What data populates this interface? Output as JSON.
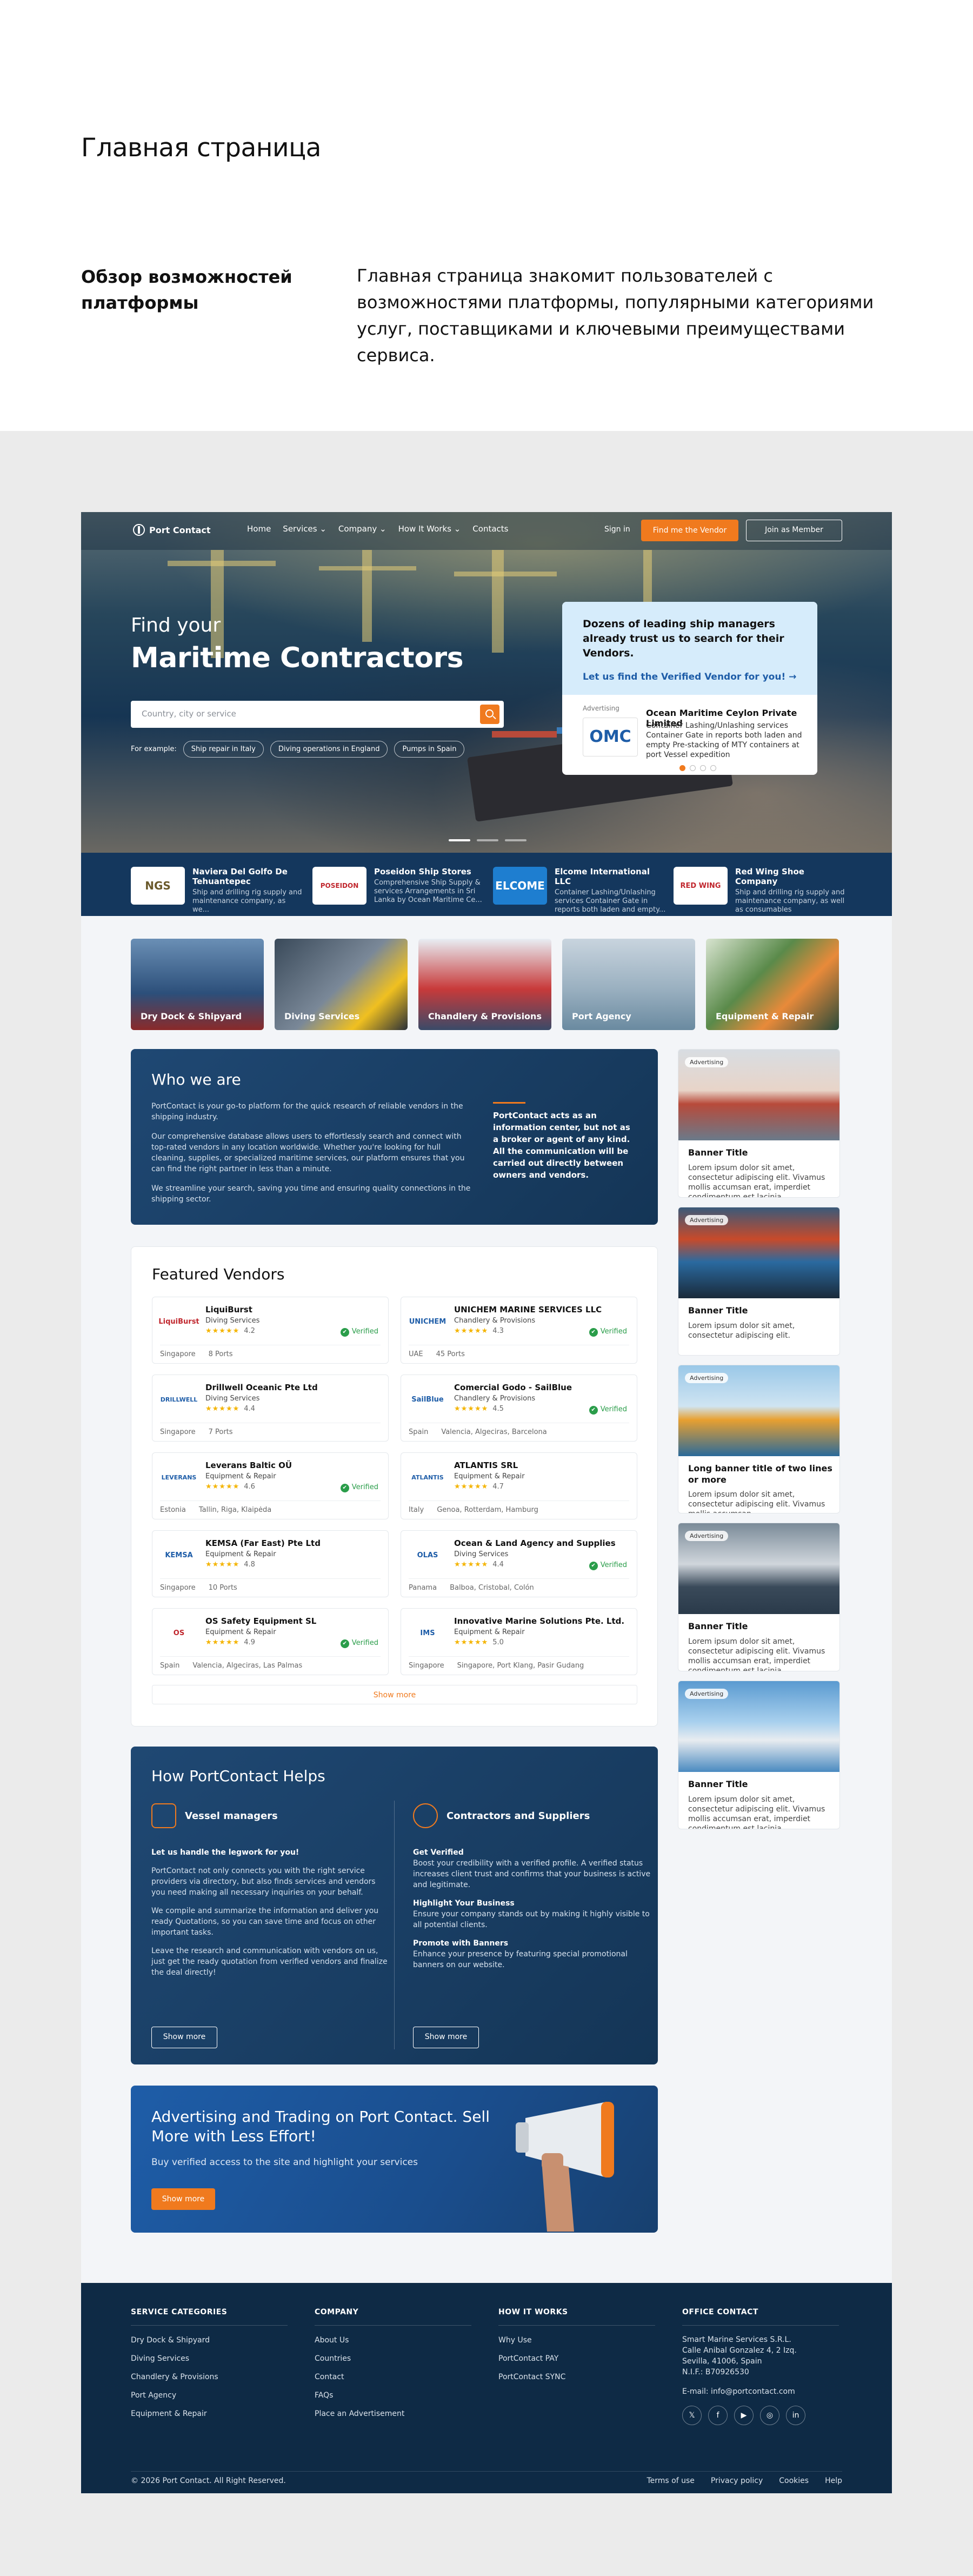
{
  "intro": {
    "title": "Главная страница",
    "subtitle": "Обзор возможностей платформы",
    "description": "Главная страница знакомит пользователей с возможностями платформы, популярными категориями услуг, поставщиками и ключевыми преимуществами сервиса."
  },
  "colors": {
    "accent": "#f07a1e",
    "navy": "#14375d",
    "blue": "#1e5da8",
    "verified": "#2a9d4a"
  },
  "nav": {
    "logo": "Port Contact",
    "links": [
      "Home",
      "Services ⌄",
      "Company ⌄",
      "How It Works ⌄",
      "Contacts"
    ],
    "signin": "Sign in",
    "find_vendor": "Find me the Vendor",
    "join": "Join as Member"
  },
  "hero": {
    "find": "Find your",
    "title": "Maritime Contractors",
    "search_placeholder": "Country, city or service",
    "example_label": "For example:",
    "examples": [
      "Ship repair in Italy",
      "Diving operations in England",
      "Pumps in Spain"
    ],
    "panel": {
      "title": "Dozens of leading ship managers already trust us to search for their Vendors.",
      "link": "Let us find the Verified Vendor for you!  →",
      "adv": "Advertising",
      "logo": "OMC",
      "name": "Ocean Maritime Ceylon Private Limited",
      "desc": "Container Lashing/Unlashing services Container Gate in reports both laden and empty Pre-stacking of MTY containers at port Vessel expedition"
    }
  },
  "sponsors": [
    {
      "logo": "NGS",
      "name": "Naviera Del Golfo De Tehuantepec",
      "desc": "Ship and drilling rig supply and maintenance company, as we..."
    },
    {
      "logo": "POSEIDON",
      "name": "Poseidon Ship Stores",
      "desc": "Comprehensive Ship Supply & services Arrangements in Sri Lanka by Ocean Maritime Ce..."
    },
    {
      "logo": "ELCOME",
      "name": "Elcome International LLC",
      "desc": "Container Lashing/Unlashing services Container Gate in reports both laden and empty..."
    },
    {
      "logo": "RED WING",
      "name": "Red Wing Shoe Company",
      "desc": "Ship and drilling rig supply and maintenance company, as well as consumables"
    }
  ],
  "categories": [
    "Dry Dock & Shipyard",
    "Diving Services",
    "Chandlery & Provisions",
    "Port Agency",
    "Equipment & Repair"
  ],
  "who": {
    "title": "Who we are",
    "p1": "PortContact is your go-to platform for the quick research of reliable vendors in the shipping industry.",
    "p2": "Our comprehensive database allows users to effortlessly search and connect with top-rated vendors in any location worldwide. Whether you're looking for hull cleaning, supplies, or specialized maritime services, our platform ensures that you can find the right partner in less than a minute.",
    "p3": "We streamline your search, saving you time and ensuring quality connections in the shipping sector.",
    "quote": "PortContact acts as an information center, but not as a broker or agent of any kind. All the communication will be carried out directly between owners and vendors."
  },
  "featured": {
    "title": "Featured Vendors",
    "show_more": "Show more",
    "vendors": [
      {
        "logo": "LiquiBurst",
        "name": "LiquiBurst",
        "service": "Diving Services",
        "stars": "★★★★★",
        "rating": "4.2",
        "verified": "Verified",
        "loc": "Singapore",
        "ports": "8 Ports"
      },
      {
        "logo": "UNICHEM",
        "name": "UNICHEM MARINE SERVICES LLC",
        "service": "Chandlery & Provisions",
        "stars": "★★★★★",
        "rating": "4.3",
        "verified": "Verified",
        "loc": "UAE",
        "ports": "45 Ports"
      },
      {
        "logo": "DRILLWELL",
        "name": "Drillwell Oceanic Pte Ltd",
        "service": "Diving Services",
        "stars": "★★★★★",
        "rating": "4.4",
        "verified": "",
        "loc": "Singapore",
        "ports": "7 Ports"
      },
      {
        "logo": "SailBlue",
        "name": "Comercial Godo - SailBlue",
        "service": "Chandlery & Provisions",
        "stars": "★★★★★",
        "rating": "4.5",
        "verified": "Verified",
        "loc": "Spain",
        "ports": "Valencia, Algeciras, Barcelona"
      },
      {
        "logo": "LEVERANS",
        "name": "Leverans Baltic OÜ",
        "service": "Equipment & Repair",
        "stars": "★★★★★",
        "rating": "4.6",
        "verified": "Verified",
        "loc": "Estonia",
        "ports": "Tallin, Riga, Klaipėda"
      },
      {
        "logo": "ATLANTIS",
        "name": "ATLANTIS SRL",
        "service": "Equipment & Repair",
        "stars": "★★★★★",
        "rating": "4.7",
        "verified": "",
        "loc": "Italy",
        "ports": "Genoa, Rotterdam, Hamburg"
      },
      {
        "logo": "KEMSA",
        "name": "KEMSA (Far East) Pte Ltd",
        "service": "Equipment & Repair",
        "stars": "★★★★★",
        "rating": "4.8",
        "verified": "",
        "loc": "Singapore",
        "ports": "10 Ports"
      },
      {
        "logo": "OLAS",
        "name": "Ocean & Land Agency and Supplies",
        "service": "Diving Services",
        "stars": "★★★★★",
        "rating": "4.4",
        "verified": "Verified",
        "loc": "Panama",
        "ports": "Balboa, Cristobal, Colón"
      },
      {
        "logo": "OS",
        "name": "OS Safety Equipment SL",
        "service": "Equipment & Repair",
        "stars": "★★★★★",
        "rating": "4.9",
        "verified": "Verified",
        "loc": "Spain",
        "ports": "Valencia, Algeciras, Las Palmas"
      },
      {
        "logo": "IMS",
        "name": "Innovative Marine Solutions Pte. Ltd.",
        "service": "Equipment & Repair",
        "stars": "★★★★★",
        "rating": "5.0",
        "verified": "",
        "loc": "Singapore",
        "ports": "Singapore, Port Klang, Pasir Gudang"
      }
    ]
  },
  "banners": [
    {
      "tag": "Advertising",
      "title": "Banner Title",
      "desc": "Lorem ipsum dolor sit amet, consectetur adipiscing elit. Vivamus mollis accumsan erat, imperdiet condimentum est lacinia..."
    },
    {
      "tag": "Advertising",
      "title": "Banner Title",
      "desc": "Lorem ipsum dolor sit amet, consectetur adipiscing elit."
    },
    {
      "tag": "Advertising",
      "title": "Long banner title of two lines or more",
      "desc": "Lorem ipsum dolor sit amet, consectetur adipiscing elit. Vivamus mollis accumsan..."
    },
    {
      "tag": "Advertising",
      "title": "Banner Title",
      "desc": "Lorem ipsum dolor sit amet, consectetur adipiscing elit. Vivamus mollis accumsan erat, imperdiet condimentum est lacinia..."
    },
    {
      "tag": "Advertising",
      "title": "Banner Title",
      "desc": "Lorem ipsum dolor sit amet, consectetur adipiscing elit. Vivamus mollis accumsan erat, imperdiet condimentum est lacinia..."
    }
  ],
  "how": {
    "title": "How PortContact Helps",
    "vessel": {
      "head": "Vessel managers",
      "b1": "Let us handle the legwork for you!",
      "p1": "PortContact not only connects you with the right service providers via directory, but also finds services and vendors you need making all necessary inquiries on your behalf.",
      "p2": "We compile and summarize the information and deliver you ready Quotations, so you can save time and focus on other important tasks.",
      "p3": "Leave the research and communication with vendors on us, just get the ready quotation from verified vendors and finalize the deal directly!",
      "btn": "Show more"
    },
    "contractors": {
      "head": "Contractors and Suppliers",
      "b1": "Get Verified",
      "p1": "Boost your credibility with a verified profile. A verified status increases client trust and confirms that your business is active and legitimate.",
      "b2": "Highlight Your Business",
      "p2": "Ensure your company stands out by making it highly visible to all potential clients.",
      "b3": "Promote with Banners",
      "p3": "Enhance your presence by featuring special promotional banners on our website.",
      "btn": "Show more"
    }
  },
  "adv": {
    "title": "Advertising and Trading on Port Contact. Sell More with Less Effort!",
    "text": "Buy verified access to the site and highlight your services",
    "btn": "Show more"
  },
  "footer": {
    "c1": {
      "head": "SERVICE CATEGORIES",
      "items": [
        "Dry Dock & Shipyard",
        "Diving Services",
        "Chandlery & Provisions",
        "Port Agency",
        "Equipment & Repair"
      ]
    },
    "c2": {
      "head": "COMPANY",
      "items": [
        "About Us",
        "Countries",
        "Contact",
        "FAQs",
        "Place an Advertisement"
      ]
    },
    "c3": {
      "head": "HOW IT WORKS",
      "items": [
        "Why Use",
        "PortContact PAY",
        "PortContact SYNC"
      ]
    },
    "c4": {
      "head": "OFFICE CONTACT",
      "addr1": "Smart Marine Services S.R.L.",
      "addr2": "Calle Anibal Gonzalez 4, 2 Izq.",
      "addr3": "Sevilla, 41006, Spain",
      "addr4": "N.I.F.: B70926530",
      "email": "E-mail: info@portcontact.com",
      "social": [
        "𝕏",
        "f",
        "▶",
        "◎",
        "in"
      ]
    },
    "copy": "© 2026 Port Contact. All Right Reserved.",
    "legal": [
      "Terms of use",
      "Privacy policy",
      "Cookies",
      "Help"
    ]
  }
}
